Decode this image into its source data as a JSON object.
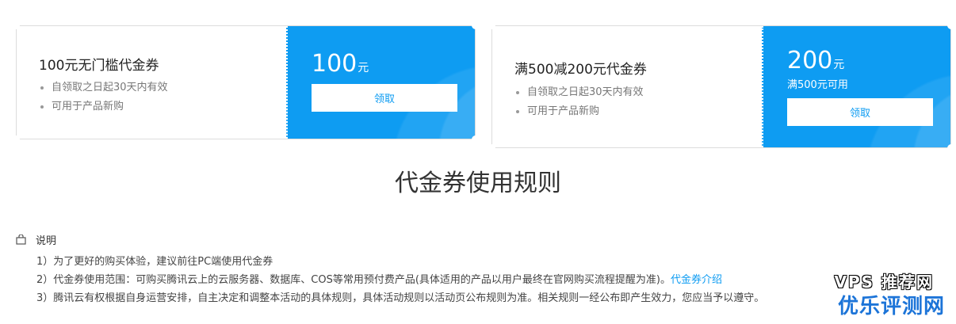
{
  "coupons": [
    {
      "title": "100元无门槛代金券",
      "bullets": [
        "自领取之日起30天内有效",
        "可用于产品新购"
      ],
      "amount": "100",
      "unit": "元",
      "condition": "",
      "claim_label": "领取"
    },
    {
      "title": "满500减200元代金券",
      "bullets": [
        "自领取之日起30天内有效",
        "可用于产品新购"
      ],
      "amount": "200",
      "unit": "元",
      "condition": "满500元可用",
      "claim_label": "领取"
    }
  ],
  "rules": {
    "title": "代金券使用规则",
    "note_label": "说明",
    "items": [
      "1）为了更好的购买体验，建议前往PC端使用代金券",
      "2）代金券使用范围：可购买腾讯云上的云服务器、数据库、COS等常用预付费产品(具体适用的产品以用户最终在官网购买流程提醒为准)。",
      "3）腾讯云有权根据自身运营安排，自主决定和调整本活动的具体规则，具体活动规则以活动页公布规则为准。相关规则一经公布即产生效力，您应当予以遵守。"
    ],
    "item2_link": "代金券介绍"
  },
  "watermark": {
    "line1": "VPS 推荐网",
    "line2": "优乐评测网"
  },
  "colors": {
    "accent": "#0e9cf2",
    "border": "#dcdcdc"
  }
}
